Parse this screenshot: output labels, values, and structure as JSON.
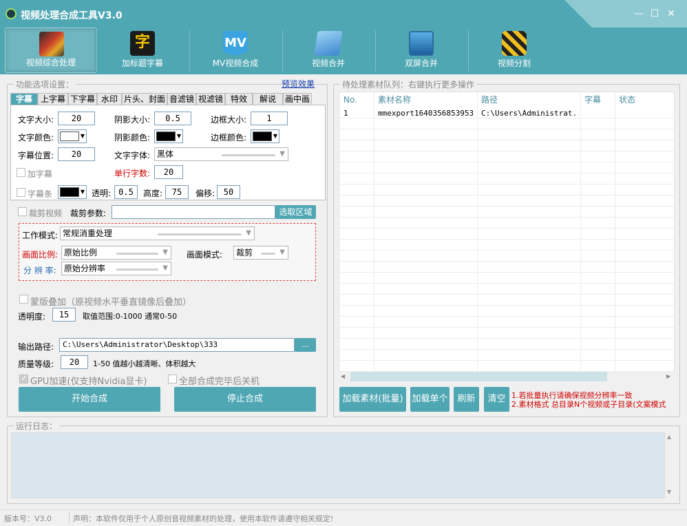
{
  "window": {
    "title": "视频处理合成工具V3.0",
    "minimize": "—",
    "maximize": "☐",
    "close": "✕"
  },
  "toolbar": [
    {
      "label": "视频综合处理",
      "icon": "film-icon"
    },
    {
      "label": "加标题字幕",
      "icon": "subtitle-icon",
      "glyph": "字"
    },
    {
      "label": "MV视频合成",
      "icon": "mv-icon",
      "glyph": "MV"
    },
    {
      "label": "视频合并",
      "icon": "folder-merge-icon"
    },
    {
      "label": "双屏合并",
      "icon": "dual-screen-icon"
    },
    {
      "label": "视频分割",
      "icon": "clapper-icon"
    }
  ],
  "settings": {
    "group_title": "功能选项设置：",
    "preview_link": "预览效果",
    "tabs": [
      "字幕",
      "上字幕",
      "下字幕",
      "水印",
      "片头、封面",
      "音滤镜",
      "视滤镜",
      "特效",
      "解说",
      "画中画"
    ],
    "font_size_label": "文字大小:",
    "font_size": "20",
    "shadow_size_label": "阴影大小:",
    "shadow_size": "0.5",
    "border_size_label": "边框大小:",
    "border_size": "1",
    "text_color_label": "文字颜色:",
    "shadow_color_label": "阴影颜色:",
    "border_color_label": "边框颜色:",
    "subtitle_pos_label": "字幕位置:",
    "subtitle_pos": "20",
    "font_family_label": "文字字体:",
    "font_family": "黑体",
    "add_subtitle_label": "加字幕",
    "line_chars_label": "单行字数:",
    "line_chars": "20",
    "bar_label": "字幕条",
    "transparency_label": "透明:",
    "transparency": "0.5",
    "height_label": "高度:",
    "height": "75",
    "offset_label": "偏移:",
    "offset": "50"
  },
  "crop": {
    "label": "裁剪视频",
    "params_label": "裁剪参数:",
    "params": "",
    "select_button": "选取区域"
  },
  "mode": {
    "work_mode_label": "工作模式:",
    "work_mode": "常规消重处理",
    "aspect_label": "画面比例:",
    "aspect": "原始比例",
    "screen_mode_label": "画面模式:",
    "screen_mode": "裁剪",
    "resolution_label": "分 辨 率:",
    "resolution": "原始分辨率"
  },
  "overlay": {
    "label": "蒙版叠加（原视频水平垂直镜像后叠加）",
    "opacity_label": "透明度:",
    "opacity": "15",
    "range_hint": "取值范围:0-1000 通常0-50"
  },
  "output": {
    "path_label": "输出路径:",
    "path": "C:\\Users\\Administrator\\Desktop\\333",
    "browse": "...",
    "quality_label": "质量等级:",
    "quality": "20",
    "quality_hint": "1-50 值越小越清晰、体积越大",
    "gpu_label": "GPU加速(仅支持Nvidia显卡)",
    "shutdown_label": "全部合成完毕后关机",
    "start_button": "开始合成",
    "stop_button": "停止合成"
  },
  "queue": {
    "group_title": "待处理素材队列：右键执行更多操作",
    "columns": [
      "No.",
      "素材名称",
      "路径",
      "字幕",
      "状态"
    ],
    "rows": [
      {
        "no": "1",
        "name": "mmexport1640356853953",
        "path": "C:\\Users\\Administrat...",
        "subtitle": "",
        "status": ""
      }
    ],
    "buttons": [
      "加载素材(批量)",
      "加载单个",
      "刷新",
      "清空"
    ],
    "note1": "1.若批量执行请确保视频分辨率一致",
    "note2": "2.素材格式 总目录N个视频或子目录(文案模式"
  },
  "log": {
    "group_title": "运行日志："
  },
  "status": {
    "version": "版本号：V3.0",
    "disclaimer": "声明：本软件仅用于个人原创音视频素材的处理，使用本软件请遵守相关规定!"
  },
  "colors": {
    "accent": "#4fa7b3",
    "accent_light": "#8fcad2",
    "warn": "#d00000"
  }
}
